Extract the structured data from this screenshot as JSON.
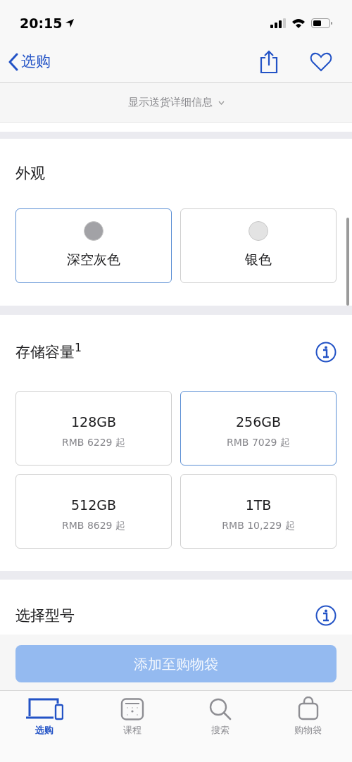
{
  "status_bar": {
    "time": "20:15"
  },
  "nav": {
    "back_label": "选购"
  },
  "delivery": {
    "label": "显示送货详细信息"
  },
  "finish": {
    "title": "外观",
    "options": [
      {
        "label": "深空灰色",
        "color": "#a2a2a6",
        "selected": true
      },
      {
        "label": "银色",
        "color": "#e3e3e3",
        "selected": false
      }
    ]
  },
  "storage": {
    "title": "存储容量$^{1}$",
    "options": [
      {
        "capacity": "128GB",
        "price": "RMB 6229 起",
        "selected": false
      },
      {
        "capacity": "256GB",
        "price": "RMB 7029 起",
        "selected": true
      },
      {
        "capacity": "512GB",
        "price": "RMB 8629 起",
        "selected": false
      },
      {
        "capacity": "1TB",
        "price": "RMB 10,229 起",
        "selected": false
      }
    ]
  },
  "model": {
    "title": "选择型号"
  },
  "add_button": {
    "label": "添加至购物袋",
    "disabled": true
  },
  "tab_bar": [
    {
      "kind": "shop",
      "label": "选购",
      "selected": true
    },
    {
      "kind": "sessions",
      "label": "课程",
      "selected": false
    },
    {
      "kind": "search",
      "label": "搜索",
      "selected": false
    },
    {
      "kind": "bag",
      "label": "购物袋",
      "selected": false
    }
  ]
}
